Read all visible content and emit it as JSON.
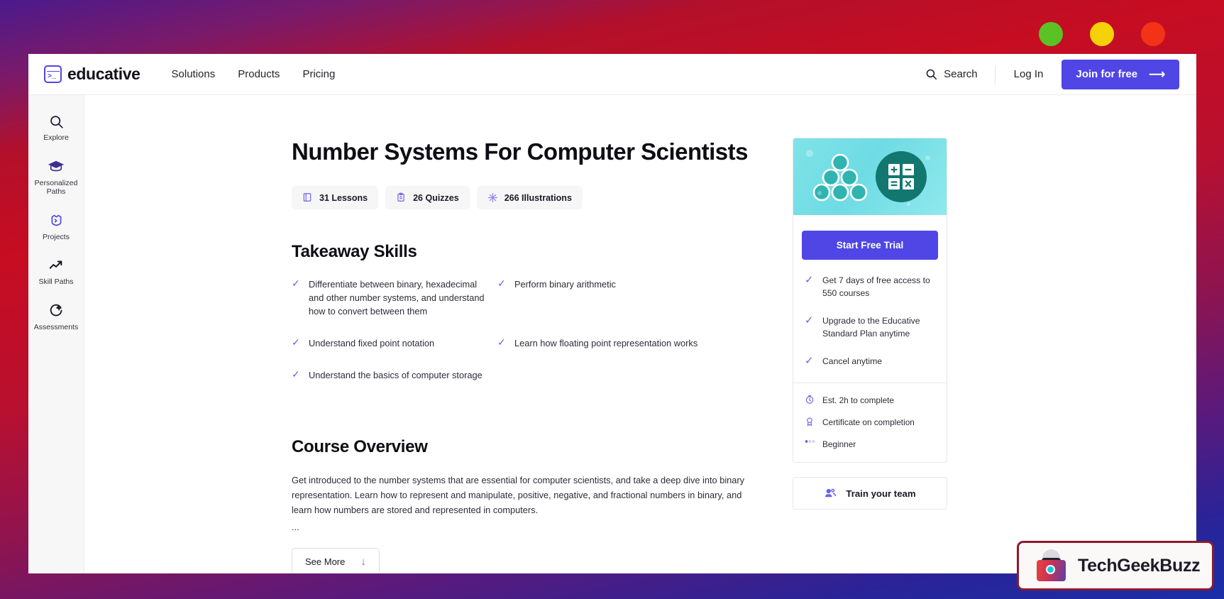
{
  "window_controls": [
    {
      "name": "minimize",
      "color": "#5bc226"
    },
    {
      "name": "maximize",
      "color": "#f5d207"
    },
    {
      "name": "close",
      "color": "#f33318"
    }
  ],
  "topnav": {
    "brand": "educative",
    "brand_chevron": ">_",
    "links": [
      "Solutions",
      "Products",
      "Pricing"
    ],
    "search_label": "Search",
    "login_label": "Log In",
    "join_label": "Join for free",
    "join_arrow": "⟶",
    "accent_color": "#4f46e5"
  },
  "sidebar": {
    "items": [
      {
        "label": "Explore",
        "icon": "search-icon"
      },
      {
        "label": "Personalized Paths",
        "icon": "graduation-cap-icon"
      },
      {
        "label": "Projects",
        "icon": "code-folder-icon"
      },
      {
        "label": "Skill Paths",
        "icon": "trending-up-icon"
      },
      {
        "label": "Assessments",
        "icon": "target-icon"
      }
    ]
  },
  "course": {
    "title": "Number Systems For Computer Scientists",
    "stats": [
      {
        "value": "31 Lessons",
        "icon": "book-icon"
      },
      {
        "value": "26 Quizzes",
        "icon": "clipboard-icon"
      },
      {
        "value": "266 Illustrations",
        "icon": "illustration-icon"
      }
    ],
    "takeaway_heading": "Takeaway Skills",
    "skills_left": [
      "Differentiate between binary, hexadecimal and other number systems, and understand how to convert between them",
      "Understand fixed point notation",
      "Understand the basics of computer storage"
    ],
    "skills_right": [
      "Perform binary arithmetic",
      "Learn how floating point representation works"
    ],
    "overview_heading": "Course Overview",
    "overview_text": "Get introduced to the number systems that are essential for computer scientists, and take a deep dive into binary representation. Learn how to represent and manipulate, positive, negative, and fractional numbers in binary, and learn how numbers are stored and represented in computers.",
    "overview_ellipsis": "...",
    "see_more_label": "See More",
    "see_more_arrow": "↓"
  },
  "trial_card": {
    "thumbnail_alt": "calculator-and-spheres-illustration",
    "cta_label": "Start Free Trial",
    "perks": [
      "Get 7 days of free access to 550 courses",
      "Upgrade to the Educative Standard Plan anytime",
      "Cancel anytime"
    ],
    "meta": [
      {
        "text": "Est. 2h to complete",
        "icon": "clock-icon"
      },
      {
        "text": "Certificate on completion",
        "icon": "award-icon"
      },
      {
        "text": "Beginner",
        "icon": "level-icon"
      }
    ],
    "team_label": "Train your team",
    "team_icon": "users-icon"
  },
  "watermark": {
    "text": "TechGeekBuzz",
    "border_color": "#8c1a2e"
  }
}
